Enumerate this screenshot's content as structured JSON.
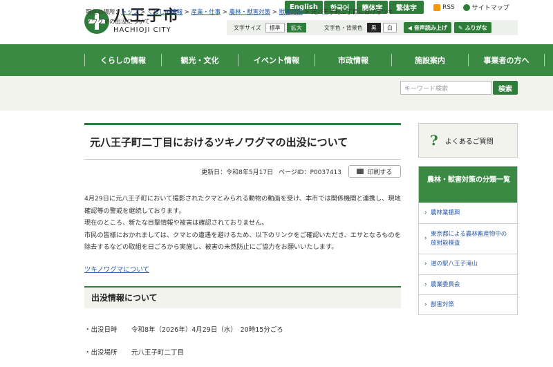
{
  "header": {
    "logo_jp": "八王子市",
    "logo_en": "HACHIOJI CITY",
    "languages": [
      "English",
      "한국어",
      "簡体字",
      "繁体字"
    ],
    "rss": "RSS",
    "sitemap": "サイトマップ",
    "font_size_label": "文字サイズ",
    "font_standard": "標準",
    "font_large": "拡大",
    "color_label": "文字色・背景色",
    "color_black": "黒",
    "color_white": "白",
    "read_aloud": "音声読み上げ",
    "furigana": "ふりがな"
  },
  "nav": [
    "くらしの情報",
    "観光・文化",
    "イベント情報",
    "市政情報",
    "施設案内",
    "事業者の方へ"
  ],
  "breadcrumb": {
    "prefix": "現在の場所：",
    "links": [
      "トップ",
      "くらしの情報",
      "産業・仕事",
      "農林・獣害対策",
      "獣害対策"
    ],
    "current": "元八王子町二丁目におけるツキノワグマの出没について"
  },
  "search": {
    "placeholder": "キーワード検索",
    "button": "検索"
  },
  "article": {
    "title": "元八王子町二丁目におけるツキノワグマの出没について",
    "updated": "更新日：令和8年5月17日",
    "page_id": "ページID：P0037413",
    "print": "印刷する",
    "paragraphs": [
      "4月29日に元八王子町において撮影されたクマとみられる動物の動画を受け、本市では関係機関と連携し、現地確認等の警戒を継続しております。",
      "現在のところ、新たな目撃情報や被害は確認されておりません。",
      "市民の皆様におかれましては、クマとの遭遇を避けるため、以下のリンクをご確認いただき、エサとなるものを除去するなどの取組を日ごろから実施し、被害の未然防止にご協力をお願いいたします。"
    ],
    "link": "ツキノワグマについて",
    "section_title": "出没情報について",
    "info": [
      {
        "key": "・出没日時",
        "value": "令和8年（2026年）4月29日（水）　20時15分ごろ"
      },
      {
        "key": "・出没場所",
        "value": "元八王子町二丁目"
      }
    ]
  },
  "sidebar": {
    "faq": "よくあるご質問",
    "category_title": "農林・獣害対策の分類一覧",
    "items": [
      "農林業振興",
      "東京都による農林畜産物中の放射能検査",
      "道の駅八王子滝山",
      "農業委員会",
      "獣害対策"
    ]
  },
  "colors": {
    "brand_green": "#2e7d3a",
    "nav_green": "#3b8a43",
    "link_blue": "#2a57a6"
  }
}
